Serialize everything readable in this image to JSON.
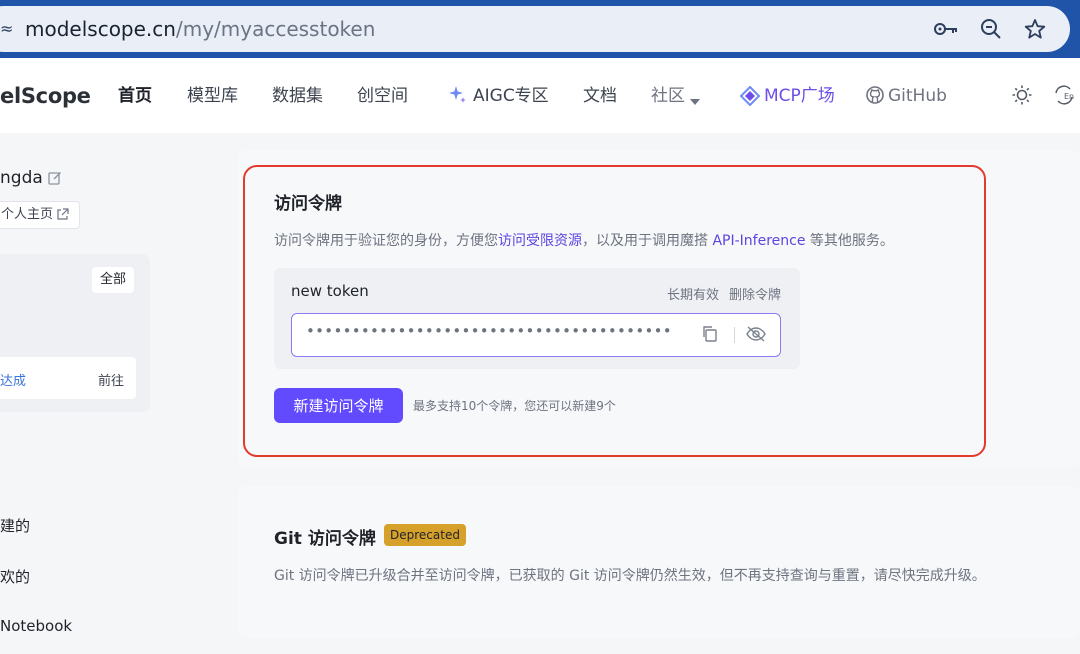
{
  "browser": {
    "url_domain": "modelscope.cn",
    "url_path": "/my/myaccesstoken"
  },
  "nav": {
    "logo": "elScope",
    "items": [
      "首页",
      "模型库",
      "数据集",
      "创空间",
      "AIGC专区",
      "文档",
      "社区",
      "MCP广场",
      "GitHub"
    ]
  },
  "sidebar": {
    "username": "ngda",
    "homepage_label": "个人主页",
    "all_label": "全部",
    "achieve_label": "达成",
    "goto_label": "前往",
    "menu": [
      "建的",
      "欢的",
      "Notebook"
    ]
  },
  "token_section": {
    "title": "访问令牌",
    "desc_prefix": "访问令牌用于验证您的身份，方便您",
    "desc_link1": "访问受限资源",
    "desc_middle": "，以及用于调用魔搭 ",
    "desc_link2": "API-Inference",
    "desc_suffix": " 等其他服务。",
    "token": {
      "name": "new token",
      "validity": "长期有效",
      "delete_label": "删除令牌",
      "masked_value": "••••••••••••••••••••••••••••••••••••••••"
    },
    "new_button": "新建访问令牌",
    "limit_hint": "最多支持10个令牌，您还可以新建9个"
  },
  "git_section": {
    "title": "Git 访问令牌",
    "badge": "Deprecated",
    "desc": "Git 访问令牌已升级合并至访问令牌，已获取的 Git 访问令牌仍然生效，但不再支持查询与重置，请尽快完成升级。"
  },
  "colors": {
    "browser_bar": "#1f54a8",
    "accent": "#624aff",
    "highlight_border": "#e23b2e",
    "badge": "#d6a12a"
  }
}
